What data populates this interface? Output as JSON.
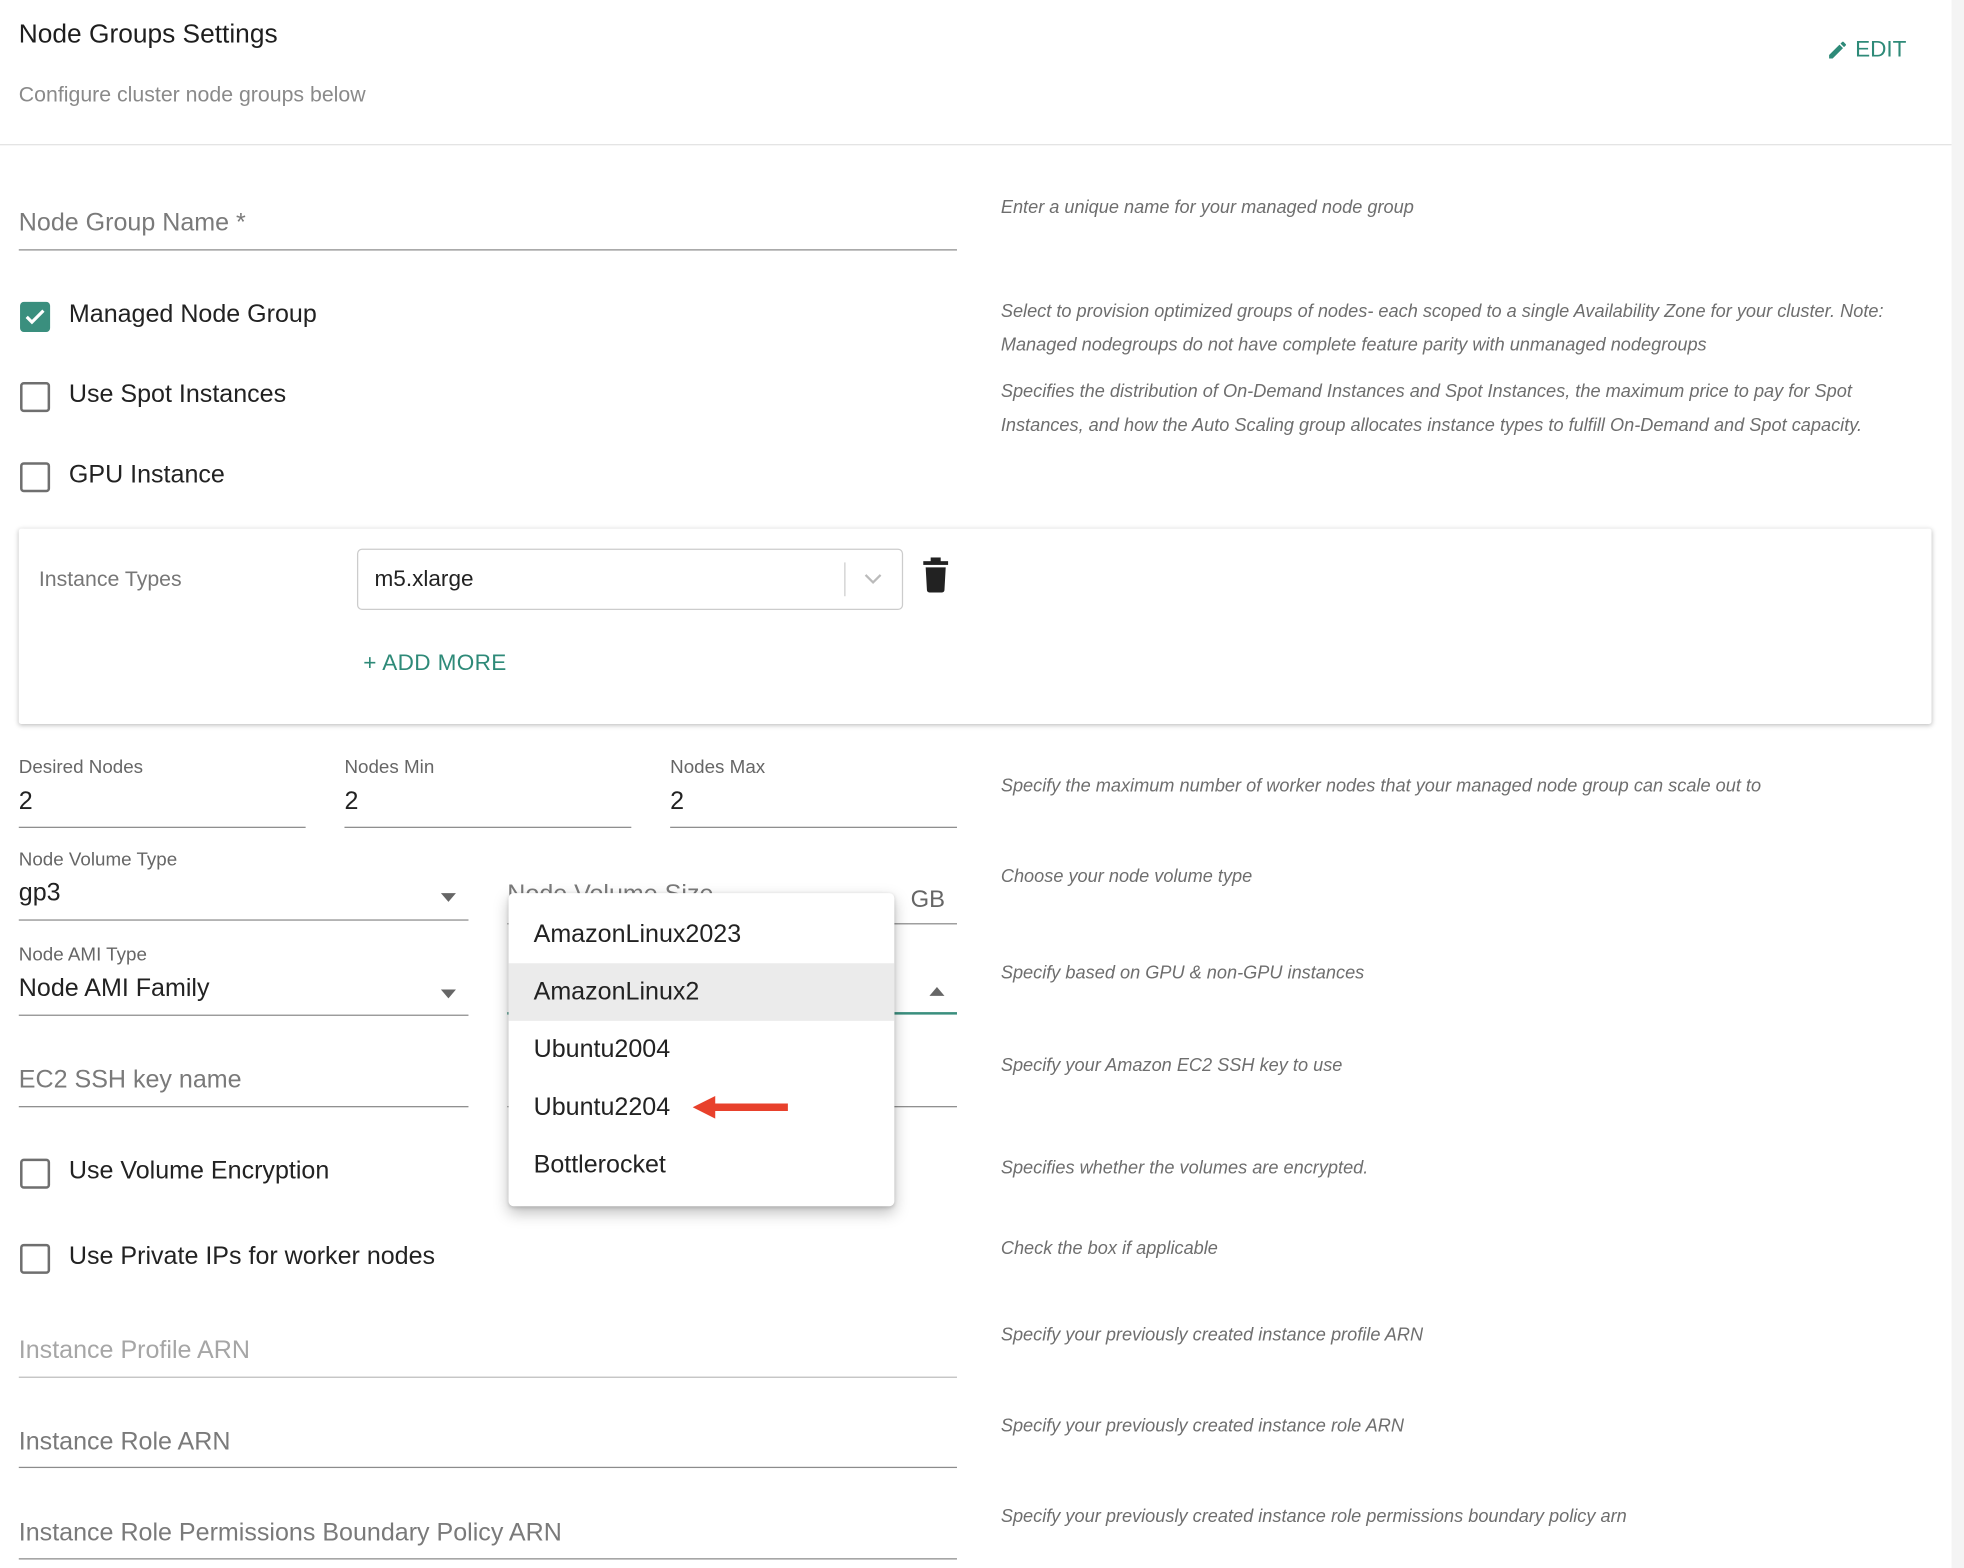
{
  "header": {
    "title": "Node Groups Settings",
    "subtitle": "Configure cluster node groups below",
    "edit_label": "EDIT",
    "accent": "#2e8a78"
  },
  "fields": {
    "node_group_name": {
      "placeholder": "Node Group Name *",
      "help": "Enter a unique name for your managed node group"
    },
    "managed_node_group": {
      "label": "Managed Node Group",
      "checked": true,
      "help": "Select to provision optimized groups of nodes- each scoped to a single Availability Zone for your cluster. Note: Managed nodegroups do not have complete feature parity with unmanaged nodegroups"
    },
    "use_spot": {
      "label": "Use Spot Instances",
      "checked": false,
      "help": "Specifies the distribution of On-Demand Instances and Spot Instances, the maximum price to pay for Spot Instances, and how the Auto Scaling group allocates instance types to fulfill On-Demand and Spot capacity."
    },
    "gpu_instance": {
      "label": "GPU Instance",
      "checked": false
    },
    "instance_types": {
      "label": "Instance Types",
      "value": "m5.xlarge",
      "add_more": "+ ADD MORE"
    },
    "desired_nodes": {
      "label": "Desired Nodes",
      "value": "2"
    },
    "nodes_min": {
      "label": "Nodes Min",
      "value": "2"
    },
    "nodes_max": {
      "label": "Nodes Max",
      "value": "2",
      "help": "Specify the maximum number of worker nodes that your managed node group can scale out to"
    },
    "node_volume_type": {
      "label": "Node Volume Type",
      "value": "gp3",
      "help": "Choose your node volume type"
    },
    "node_volume_size": {
      "label": "Node Volume Size",
      "unit": "GB"
    },
    "node_ami_type": {
      "label": "Node AMI Type",
      "value": "Node AMI Family",
      "help": "Specify based on GPU & non-GPU instances"
    },
    "ec2_ssh_key": {
      "placeholder": "EC2 SSH key name",
      "help": "Specify your Amazon EC2 SSH key to use"
    },
    "volume_encryption": {
      "label": "Use Volume Encryption",
      "checked": false,
      "help": "Specifies whether the volumes are encrypted."
    },
    "private_ips": {
      "label": "Use Private IPs for worker nodes",
      "checked": false,
      "help": "Check the box if applicable"
    },
    "instance_profile_arn": {
      "placeholder": "Instance Profile ARN",
      "help": "Specify your previously created instance profile ARN"
    },
    "instance_role_arn": {
      "placeholder": "Instance Role ARN",
      "help": "Specify your previously created instance role ARN"
    },
    "permissions_boundary": {
      "placeholder": "Instance Role Permissions Boundary Policy ARN",
      "help": "Specify your previously created instance role permissions boundary policy arn"
    }
  },
  "dropdown": {
    "options": [
      "AmazonLinux2023",
      "AmazonLinux2",
      "Ubuntu2004",
      "Ubuntu2204",
      "Bottlerocket"
    ],
    "highlighted": "AmazonLinux2",
    "annotated": "Ubuntu2204",
    "annotation_color": "#e8412c"
  }
}
